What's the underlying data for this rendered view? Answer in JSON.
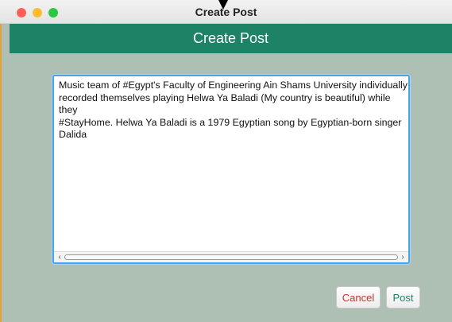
{
  "window": {
    "title": "Create Post"
  },
  "header": {
    "title": "Create Post"
  },
  "post": {
    "text": "Music team of #Egypt's Faculty of Engineering Ain Shams University individually\nrecorded themselves playing Helwa Ya Baladi (My country is beautiful) while they\n#StayHome. Helwa Ya Baladi is a 1979 Egyptian song by Egyptian-born singer Dalida"
  },
  "icons": {
    "scroll_left": "‹",
    "scroll_right": "›"
  },
  "buttons": {
    "cancel": "Cancel",
    "post": "Post"
  },
  "colors": {
    "header": "#1e8267",
    "background": "#aebfb3",
    "focus_ring": "#4aa3e3",
    "cancel_text": "#c0392b",
    "post_text": "#1e8267"
  }
}
